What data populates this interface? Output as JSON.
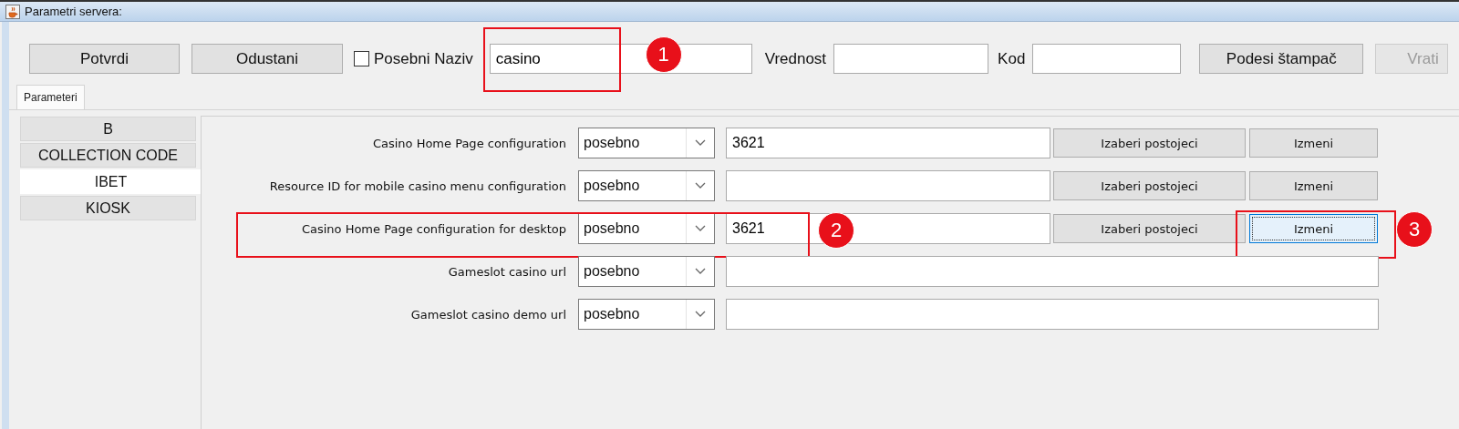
{
  "window": {
    "title": "Parametri servera:"
  },
  "toolbar": [
    {
      "kind": "button",
      "label": "Potvrdi",
      "disabled": false
    },
    {
      "kind": "button",
      "label": "Odustani",
      "disabled": false
    },
    {
      "kind": "checkbox",
      "label": "Posebni Naziv",
      "checked": false
    },
    {
      "kind": "field",
      "value": "casino",
      "callout": "1"
    },
    {
      "kind": "label",
      "text": "Vrednost"
    },
    {
      "kind": "field"
    },
    {
      "kind": "label",
      "text": "Kod"
    },
    {
      "kind": "field"
    },
    {
      "kind": "button",
      "label": "Podesi štampač",
      "disabled": false
    },
    {
      "kind": "button",
      "label": "Vrati",
      "disabled": true
    }
  ],
  "tabs": [
    {
      "label": "Parameteri",
      "selected": true
    }
  ],
  "categories": [
    {
      "label": "B",
      "selected": false
    },
    {
      "label": "COLLECTION CODE",
      "selected": false
    },
    {
      "label": "IBET",
      "selected": true
    },
    {
      "label": "KIOSK",
      "selected": false
    }
  ],
  "parameters": [
    {
      "label": "Casino Home Page configuration",
      "mode": "posebno",
      "value": "3621",
      "buttons": [
        {
          "label": "Izaberi postojeci",
          "focused": false
        },
        {
          "label": "Izmeni",
          "focused": false
        }
      ]
    },
    {
      "label": "Resource ID for mobile casino menu configuration",
      "mode": "posebno",
      "buttons": [
        {
          "label": "Izaberi postojeci",
          "focused": false
        },
        {
          "label": "Izmeni",
          "focused": false
        }
      ]
    },
    {
      "label": "Casino Home Page configuration for desktop",
      "mode": "posebno",
      "value": "3621",
      "callout": "2",
      "buttons": [
        {
          "label": "Izaberi postojeci",
          "focused": false
        },
        {
          "label": "Izmeni",
          "focused": true,
          "callout": "3"
        }
      ]
    },
    {
      "label": "Gameslot casino url",
      "mode": "posebno"
    },
    {
      "label": "Gameslot casino demo url",
      "mode": "posebno"
    }
  ]
}
